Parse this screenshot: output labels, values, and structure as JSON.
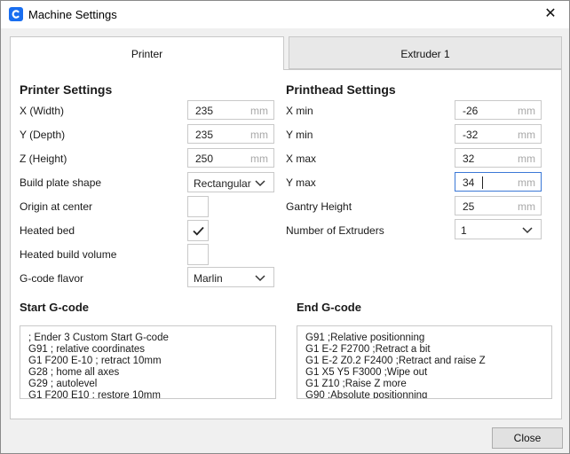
{
  "window": {
    "title": "Machine Settings",
    "close_glyph": "✕"
  },
  "tabs": [
    {
      "label": "Printer",
      "active": true
    },
    {
      "label": "Extruder 1",
      "active": false
    }
  ],
  "printer_settings": {
    "title": "Printer Settings",
    "x_width": {
      "label": "X (Width)",
      "value": "235",
      "unit": "mm"
    },
    "y_depth": {
      "label": "Y (Depth)",
      "value": "235",
      "unit": "mm"
    },
    "z_height": {
      "label": "Z (Height)",
      "value": "250",
      "unit": "mm"
    },
    "build_plate_shape": {
      "label": "Build plate shape",
      "value": "Rectangular"
    },
    "origin_at_center": {
      "label": "Origin at center",
      "checked": false
    },
    "heated_bed": {
      "label": "Heated bed",
      "checked": true
    },
    "heated_build_volume": {
      "label": "Heated build volume",
      "checked": false
    },
    "gcode_flavor": {
      "label": "G-code flavor",
      "value": "Marlin"
    }
  },
  "printhead_settings": {
    "title": "Printhead Settings",
    "x_min": {
      "label": "X min",
      "value": "-26",
      "unit": "mm"
    },
    "y_min": {
      "label": "Y min",
      "value": "-32",
      "unit": "mm"
    },
    "x_max": {
      "label": "X max",
      "value": "32",
      "unit": "mm"
    },
    "y_max": {
      "label": "Y max",
      "value": "34",
      "unit": "mm"
    },
    "gantry_height": {
      "label": "Gantry Height",
      "value": "25",
      "unit": "mm"
    },
    "number_of_extruders": {
      "label": "Number of Extruders",
      "value": "1"
    }
  },
  "start_gcode": {
    "title": "Start G-code",
    "lines": [
      "; Ender 3 Custom Start G-code",
      "G91 ; relative coordinates",
      "G1 F200 E-10 ; retract 10mm",
      "G28 ; home all axes",
      "G29 ; autolevel",
      "G1 F200 E10 ; restore 10mm"
    ]
  },
  "end_gcode": {
    "title": "End G-code",
    "lines": [
      "G91 ;Relative positionning",
      "G1 E-2 F2700 ;Retract a bit",
      "G1 E-2 Z0.2 F2400 ;Retract and raise Z",
      "G1 X5 Y5 F3000 ;Wipe out",
      "G1 Z10 ;Raise Z more",
      "G90 ;Absolute positionning"
    ]
  },
  "footer": {
    "close_label": "Close"
  },
  "icons": {
    "app": "cura-logo-icon",
    "check": "checkmark-icon",
    "dropdown": "chevron-down-icon"
  },
  "colors": {
    "accent": "#196ef0",
    "focus_border": "#3b78d6",
    "unit_text": "#a8a8a8"
  }
}
